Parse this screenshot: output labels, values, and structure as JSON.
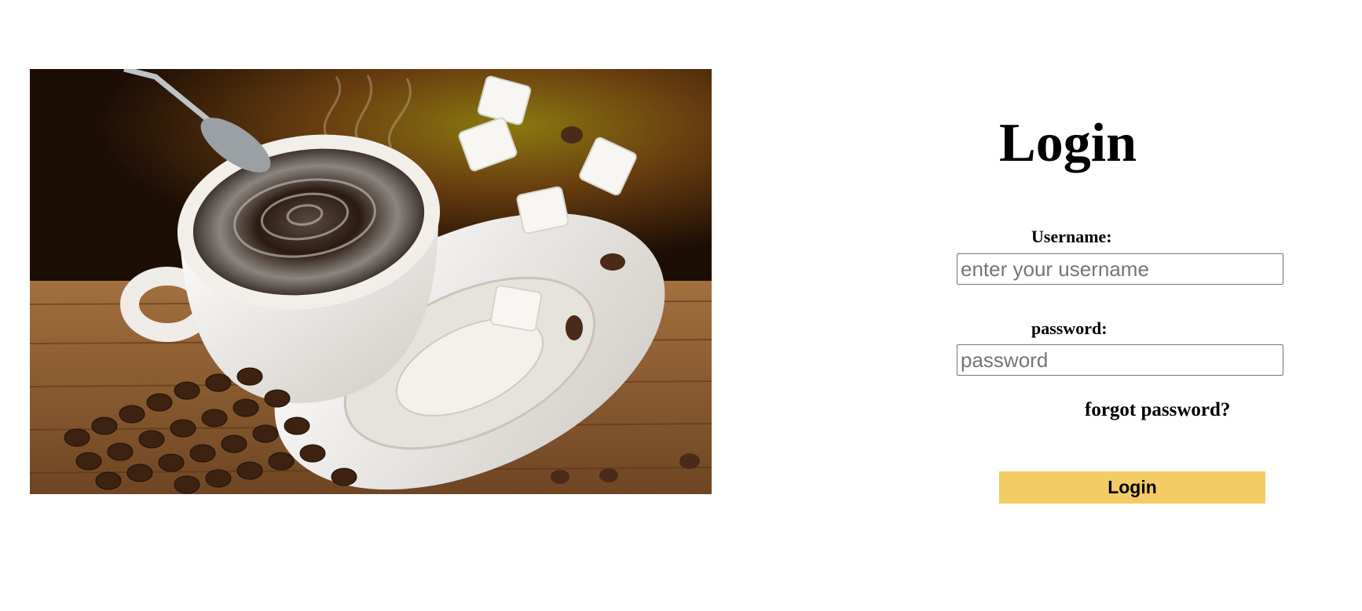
{
  "hero": {
    "image_description_icon": "coffee-cup-photo"
  },
  "login": {
    "title": "Login",
    "username_label": "Username:",
    "username_placeholder": "enter your username",
    "username_value": "",
    "password_label": "password:",
    "password_placeholder": "password",
    "password_value": "",
    "forgot_label": "forgot password?",
    "submit_label": "Login"
  },
  "colors": {
    "accent": "#f4cc66",
    "background": "#ffffff",
    "text": "#000000"
  }
}
